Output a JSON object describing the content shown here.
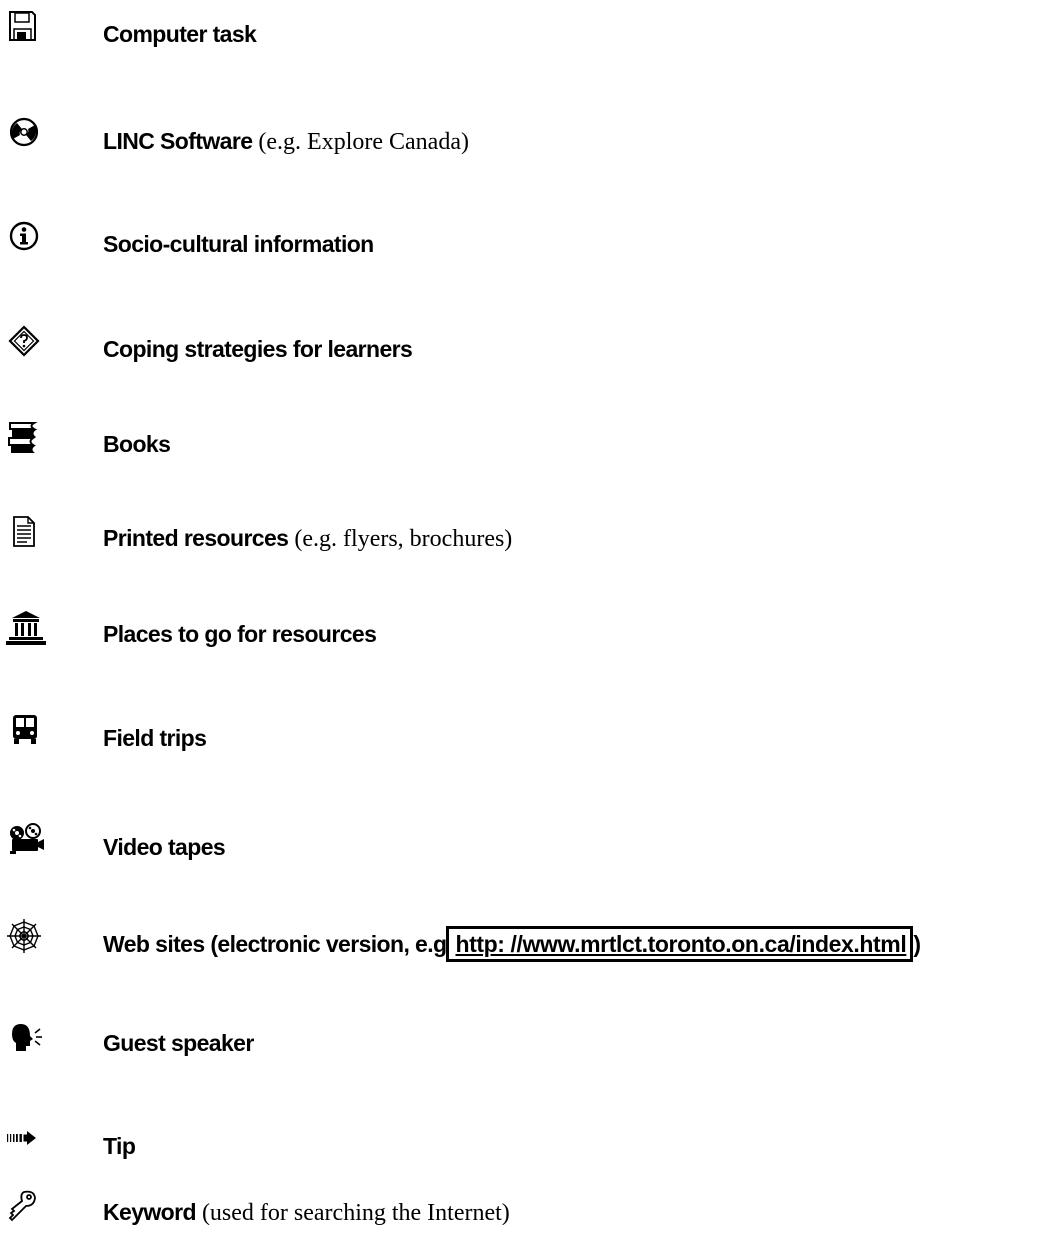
{
  "legend": {
    "items": [
      {
        "icon": "floppy-disk-icon",
        "label": "Computer task",
        "note": ""
      },
      {
        "icon": "cd-rom-icon",
        "label": "LINC Software",
        "note": " (e.g. Explore Canada)"
      },
      {
        "icon": "info-circle-icon",
        "label": "Socio-cultural information",
        "note": ""
      },
      {
        "icon": "question-diamond-icon",
        "label": "Coping strategies for learners",
        "note": ""
      },
      {
        "icon": "books-icon",
        "label": "Books",
        "note": ""
      },
      {
        "icon": "document-icon",
        "label": "Printed resources",
        "note": " (e.g. flyers, brochures)"
      },
      {
        "icon": "building-icon",
        "label": "Places to go for resources",
        "note": ""
      },
      {
        "icon": "bus-icon",
        "label": "Field trips",
        "note": ""
      },
      {
        "icon": "film-projector-icon",
        "label": "Video tapes",
        "note": ""
      },
      {
        "icon": "spider-web-icon",
        "label": "Web sites (electronic version, e.g",
        "note": ""
      },
      {
        "icon": "speaking-head-icon",
        "label": "Guest speaker",
        "note": ""
      },
      {
        "icon": "arrow-icon",
        "label": "Tip",
        "note": ""
      },
      {
        "icon": "key-icon",
        "label": "Keyword",
        "note": " (used for searching the Internet)"
      }
    ],
    "web_link": {
      "url_text": " http: //www.mrtlct.toronto.on.ca/index.html",
      "suffix": ")"
    }
  }
}
